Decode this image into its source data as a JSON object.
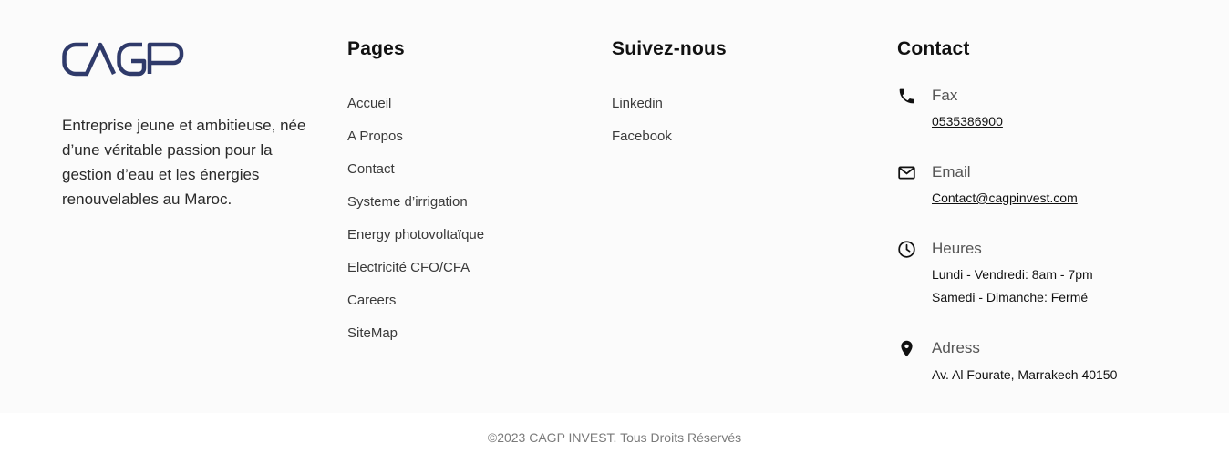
{
  "brand": {
    "logo_text": "CAGP",
    "logo_color": "#2f3a6a",
    "description": "Entreprise jeune et ambitieuse, née d’une véritable passion pour la gestion d’eau et les énergies renouvelables au Maroc."
  },
  "pages": {
    "title": "Pages",
    "links": [
      "Accueil",
      "A Propos",
      "Contact",
      "Systeme d’irrigation",
      "Energy photovoltaïque",
      "Electricité CFO/CFA",
      "Careers",
      "SiteMap"
    ]
  },
  "follow": {
    "title": "Suivez-nous",
    "links": [
      "Linkedin",
      "Facebook"
    ]
  },
  "contact": {
    "title": "Contact",
    "fax": {
      "icon": "phone-icon",
      "label": "Fax",
      "value": "0535386900"
    },
    "email": {
      "icon": "envelope-icon",
      "label": "Email",
      "value": "Contact@cagpinvest.com"
    },
    "hours": {
      "icon": "clock-icon",
      "label": "Heures",
      "weekdays": "Lundi - Vendredi: 8am - 7pm",
      "weekend": "Samedi - Dimanche: Fermé"
    },
    "address": {
      "icon": "map-pin-icon",
      "label": "Adress",
      "value": "Av. Al Fourate, Marrakech 40150"
    }
  },
  "footer": {
    "copyright": "©2023 CAGP INVEST. Tous Droits Réservés"
  }
}
